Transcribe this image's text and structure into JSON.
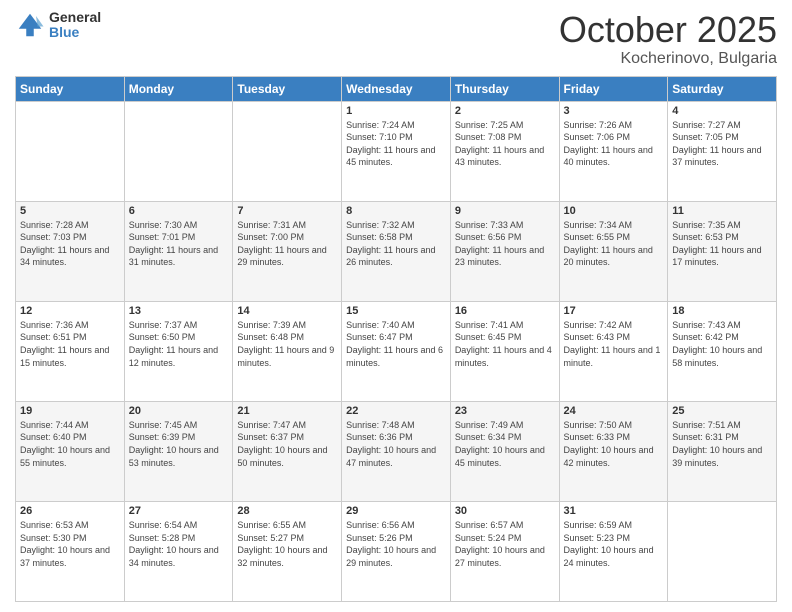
{
  "header": {
    "logo_general": "General",
    "logo_blue": "Blue",
    "month": "October 2025",
    "location": "Kocherinovo, Bulgaria"
  },
  "days_of_week": [
    "Sunday",
    "Monday",
    "Tuesday",
    "Wednesday",
    "Thursday",
    "Friday",
    "Saturday"
  ],
  "weeks": [
    [
      {
        "day": "",
        "sunrise": "",
        "sunset": "",
        "daylight": ""
      },
      {
        "day": "",
        "sunrise": "",
        "sunset": "",
        "daylight": ""
      },
      {
        "day": "",
        "sunrise": "",
        "sunset": "",
        "daylight": ""
      },
      {
        "day": "1",
        "sunrise": "Sunrise: 7:24 AM",
        "sunset": "Sunset: 7:10 PM",
        "daylight": "Daylight: 11 hours and 45 minutes."
      },
      {
        "day": "2",
        "sunrise": "Sunrise: 7:25 AM",
        "sunset": "Sunset: 7:08 PM",
        "daylight": "Daylight: 11 hours and 43 minutes."
      },
      {
        "day": "3",
        "sunrise": "Sunrise: 7:26 AM",
        "sunset": "Sunset: 7:06 PM",
        "daylight": "Daylight: 11 hours and 40 minutes."
      },
      {
        "day": "4",
        "sunrise": "Sunrise: 7:27 AM",
        "sunset": "Sunset: 7:05 PM",
        "daylight": "Daylight: 11 hours and 37 minutes."
      }
    ],
    [
      {
        "day": "5",
        "sunrise": "Sunrise: 7:28 AM",
        "sunset": "Sunset: 7:03 PM",
        "daylight": "Daylight: 11 hours and 34 minutes."
      },
      {
        "day": "6",
        "sunrise": "Sunrise: 7:30 AM",
        "sunset": "Sunset: 7:01 PM",
        "daylight": "Daylight: 11 hours and 31 minutes."
      },
      {
        "day": "7",
        "sunrise": "Sunrise: 7:31 AM",
        "sunset": "Sunset: 7:00 PM",
        "daylight": "Daylight: 11 hours and 29 minutes."
      },
      {
        "day": "8",
        "sunrise": "Sunrise: 7:32 AM",
        "sunset": "Sunset: 6:58 PM",
        "daylight": "Daylight: 11 hours and 26 minutes."
      },
      {
        "day": "9",
        "sunrise": "Sunrise: 7:33 AM",
        "sunset": "Sunset: 6:56 PM",
        "daylight": "Daylight: 11 hours and 23 minutes."
      },
      {
        "day": "10",
        "sunrise": "Sunrise: 7:34 AM",
        "sunset": "Sunset: 6:55 PM",
        "daylight": "Daylight: 11 hours and 20 minutes."
      },
      {
        "day": "11",
        "sunrise": "Sunrise: 7:35 AM",
        "sunset": "Sunset: 6:53 PM",
        "daylight": "Daylight: 11 hours and 17 minutes."
      }
    ],
    [
      {
        "day": "12",
        "sunrise": "Sunrise: 7:36 AM",
        "sunset": "Sunset: 6:51 PM",
        "daylight": "Daylight: 11 hours and 15 minutes."
      },
      {
        "day": "13",
        "sunrise": "Sunrise: 7:37 AM",
        "sunset": "Sunset: 6:50 PM",
        "daylight": "Daylight: 11 hours and 12 minutes."
      },
      {
        "day": "14",
        "sunrise": "Sunrise: 7:39 AM",
        "sunset": "Sunset: 6:48 PM",
        "daylight": "Daylight: 11 hours and 9 minutes."
      },
      {
        "day": "15",
        "sunrise": "Sunrise: 7:40 AM",
        "sunset": "Sunset: 6:47 PM",
        "daylight": "Daylight: 11 hours and 6 minutes."
      },
      {
        "day": "16",
        "sunrise": "Sunrise: 7:41 AM",
        "sunset": "Sunset: 6:45 PM",
        "daylight": "Daylight: 11 hours and 4 minutes."
      },
      {
        "day": "17",
        "sunrise": "Sunrise: 7:42 AM",
        "sunset": "Sunset: 6:43 PM",
        "daylight": "Daylight: 11 hours and 1 minute."
      },
      {
        "day": "18",
        "sunrise": "Sunrise: 7:43 AM",
        "sunset": "Sunset: 6:42 PM",
        "daylight": "Daylight: 10 hours and 58 minutes."
      }
    ],
    [
      {
        "day": "19",
        "sunrise": "Sunrise: 7:44 AM",
        "sunset": "Sunset: 6:40 PM",
        "daylight": "Daylight: 10 hours and 55 minutes."
      },
      {
        "day": "20",
        "sunrise": "Sunrise: 7:45 AM",
        "sunset": "Sunset: 6:39 PM",
        "daylight": "Daylight: 10 hours and 53 minutes."
      },
      {
        "day": "21",
        "sunrise": "Sunrise: 7:47 AM",
        "sunset": "Sunset: 6:37 PM",
        "daylight": "Daylight: 10 hours and 50 minutes."
      },
      {
        "day": "22",
        "sunrise": "Sunrise: 7:48 AM",
        "sunset": "Sunset: 6:36 PM",
        "daylight": "Daylight: 10 hours and 47 minutes."
      },
      {
        "day": "23",
        "sunrise": "Sunrise: 7:49 AM",
        "sunset": "Sunset: 6:34 PM",
        "daylight": "Daylight: 10 hours and 45 minutes."
      },
      {
        "day": "24",
        "sunrise": "Sunrise: 7:50 AM",
        "sunset": "Sunset: 6:33 PM",
        "daylight": "Daylight: 10 hours and 42 minutes."
      },
      {
        "day": "25",
        "sunrise": "Sunrise: 7:51 AM",
        "sunset": "Sunset: 6:31 PM",
        "daylight": "Daylight: 10 hours and 39 minutes."
      }
    ],
    [
      {
        "day": "26",
        "sunrise": "Sunrise: 6:53 AM",
        "sunset": "Sunset: 5:30 PM",
        "daylight": "Daylight: 10 hours and 37 minutes."
      },
      {
        "day": "27",
        "sunrise": "Sunrise: 6:54 AM",
        "sunset": "Sunset: 5:28 PM",
        "daylight": "Daylight: 10 hours and 34 minutes."
      },
      {
        "day": "28",
        "sunrise": "Sunrise: 6:55 AM",
        "sunset": "Sunset: 5:27 PM",
        "daylight": "Daylight: 10 hours and 32 minutes."
      },
      {
        "day": "29",
        "sunrise": "Sunrise: 6:56 AM",
        "sunset": "Sunset: 5:26 PM",
        "daylight": "Daylight: 10 hours and 29 minutes."
      },
      {
        "day": "30",
        "sunrise": "Sunrise: 6:57 AM",
        "sunset": "Sunset: 5:24 PM",
        "daylight": "Daylight: 10 hours and 27 minutes."
      },
      {
        "day": "31",
        "sunrise": "Sunrise: 6:59 AM",
        "sunset": "Sunset: 5:23 PM",
        "daylight": "Daylight: 10 hours and 24 minutes."
      },
      {
        "day": "",
        "sunrise": "",
        "sunset": "",
        "daylight": ""
      }
    ]
  ]
}
